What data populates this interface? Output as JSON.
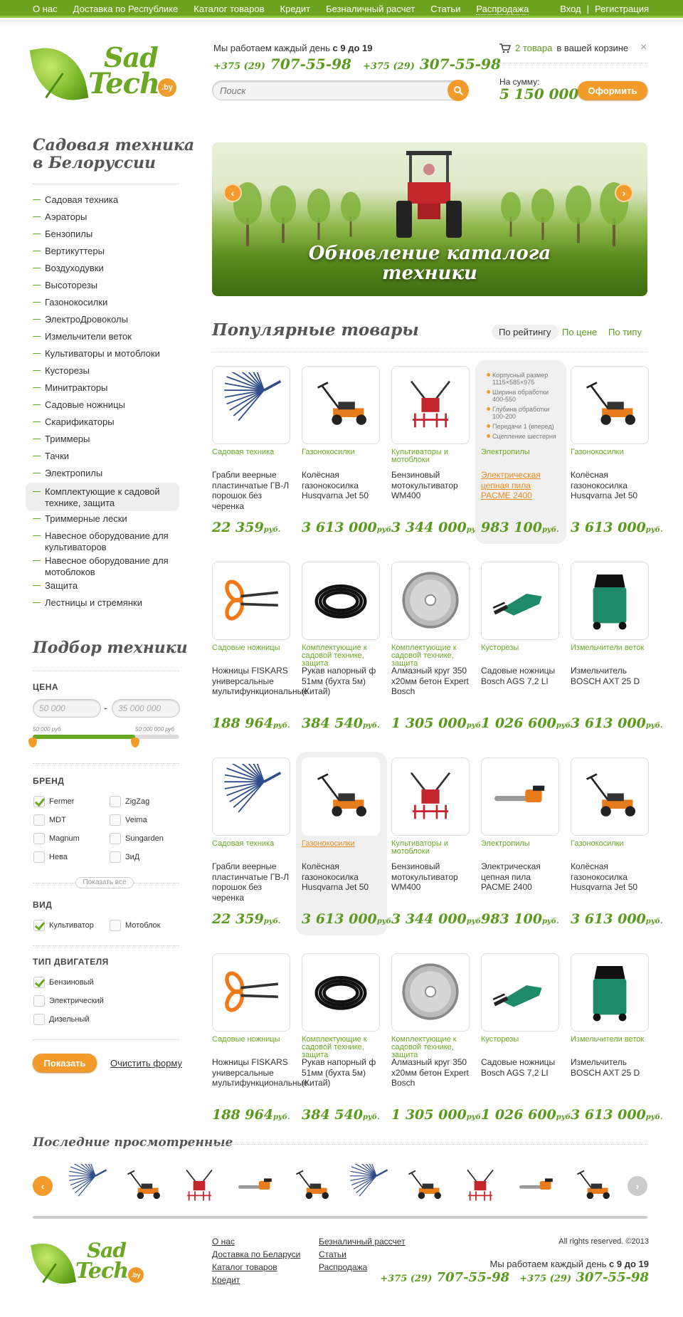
{
  "topnav": {
    "items": [
      "О нас",
      "Доставка по Республике",
      "Каталог товаров",
      "Кредит",
      "Безналичный расчет",
      "Статьи",
      "Распродажа"
    ],
    "login": "Вход",
    "sep": "|",
    "register": "Регистрация"
  },
  "logo": {
    "line1": "Sad",
    "line2": "Tech",
    "badge": ".by"
  },
  "header": {
    "work_prefix": "Мы работаем каждый день",
    "work_hours": "с 9 до 19",
    "phones": [
      {
        "code": "+375 (29)",
        "number": "707-55-98"
      },
      {
        "code": "+375 (29)",
        "number": "307-55-98"
      }
    ],
    "search_placeholder": "Поиск"
  },
  "cart": {
    "link": "2 товара",
    "text": "в вашей корзине",
    "close": "×",
    "sum_label": "На сумму:",
    "sum_value": "5 150 000",
    "order_btn": "Оформить"
  },
  "sidebar": {
    "title_line1": "Садовая техника",
    "title_line2": "в Белоруссии",
    "categories": [
      "Садовая техника",
      "Аэраторы",
      "Бензопилы",
      "Вертикуттеры",
      "Воздуходувки",
      "Высоторезы",
      "Газонокосилки",
      "ЭлектроДровоколы",
      "Измельчители веток",
      "Культиваторы и мотоблоки",
      "Кусторезы",
      "Минитракторы",
      "Садовые ножницы",
      "Скарификаторы",
      "Триммеры",
      "Тачки",
      "Электропилы",
      "Комплектующие к садовой технике, защита",
      "Триммерные лески",
      "Навесное оборудование для культиваторов",
      "Навесное оборудование для мотоблоков",
      "Защита",
      "Лестницы и стремянки"
    ],
    "active_index": 17
  },
  "filter": {
    "title": "Подбор техники",
    "price_head": "ЦЕНА",
    "price_from_placeholder": "50 000",
    "price_dash": "-",
    "price_to_placeholder": "35 000 000",
    "slider_min_label": "50 000 руб",
    "slider_max_label": "50 000 000 руб",
    "slider_range": [
      0.0,
      0.7
    ],
    "brand_head": "БРЕНД",
    "brands": [
      {
        "label": "Fermer",
        "checked": true
      },
      {
        "label": "ZigZag",
        "checked": false
      },
      {
        "label": "MDT",
        "checked": false
      },
      {
        "label": "Veima",
        "checked": false
      },
      {
        "label": "Magnum",
        "checked": false
      },
      {
        "label": "Sungarden",
        "checked": false
      },
      {
        "label": "Нева",
        "checked": false
      },
      {
        "label": "ЗиД",
        "checked": false
      }
    ],
    "show_all": "Показать все",
    "kind_head": "ВИД",
    "kinds": [
      {
        "label": "Культиватор",
        "checked": true
      },
      {
        "label": "Мотоблок",
        "checked": false
      }
    ],
    "engine_head": "ТИП ДВИГАТЕЛЯ",
    "engines": [
      {
        "label": "Бензиновый",
        "checked": true
      },
      {
        "label": "Электрический",
        "checked": false
      },
      {
        "label": "Дизельный",
        "checked": false
      }
    ],
    "show_btn": "Показать",
    "clear_link": "Очистить форму"
  },
  "banner": {
    "title_line1": "Обновление каталога",
    "title_line2": "техники",
    "prev": "‹",
    "next": "›"
  },
  "popular": {
    "title": "Популярные товары",
    "sort": [
      "По рейтингу",
      "По цене",
      "По типу"
    ],
    "currency": "руб.",
    "rows": [
      [
        {
          "cat": "Садовая техника",
          "name": "Грабли веерные пластинчатые ГВ-Л порошок без черенка",
          "price": "22 359",
          "img": "rake-icon"
        },
        {
          "cat": "Газонокосилки",
          "name": "Колёсная газонокосилка Husqvarna Jet 50",
          "price": "3 613 000",
          "img": "lawnmower-icon"
        },
        {
          "cat": "Культиваторы и мотоблоки",
          "name": "Бензиновый мотокультиватор WM400",
          "price": "3 344 000",
          "img": "cultivator-icon"
        },
        {
          "cat": "Электропилы",
          "name": "Электрическая цепная пила PACME 2400",
          "price": "983 100",
          "img": "specs",
          "highlight": true,
          "specs": [
            "Корпусный размер 1115×585×975",
            "Ширина обработки 400-550",
            "Глубина обработки 100-200",
            "Передачи 1 (вперед)",
            "Сцепление шестерня"
          ]
        },
        {
          "cat": "Газонокосилки",
          "name": "Колёсная газонокосилка Husqvarna Jet 50",
          "price": "3 613 000",
          "img": "lawnmower-icon"
        }
      ],
      [
        {
          "cat": "Садовые ножницы",
          "name": "Ножницы FISKARS универсальные мультифункциональные",
          "price": "188 964",
          "img": "scissors-icon"
        },
        {
          "cat": "Комплектующие к садовой технике, защита",
          "name": "Рукав напорный ф 51мм (бухта 5м) (Китай)",
          "price": "384 540",
          "img": "hose-icon"
        },
        {
          "cat": "Комплектующие к садовой технике, защита",
          "name": "Алмазный круг 350 x20мм бетон Expert Bosch",
          "price": "1 305 000",
          "img": "disc-icon"
        },
        {
          "cat": "Кусторезы",
          "name": "Садовые ножницы Bosch AGS 7,2 LI",
          "price": "1 026 600",
          "img": "shears-icon"
        },
        {
          "cat": "Измельчители веток",
          "name": "Измельчитель BOSCH AXT 25 D",
          "price": "3 613 000",
          "img": "shredder-icon"
        }
      ],
      [
        {
          "cat": "Садовая техника",
          "name": "Грабли веерные пластинчатые ГВ-Л порошок без черенка",
          "price": "22 359",
          "img": "rake-icon"
        },
        {
          "cat": "Газонокосилки",
          "name": "Колёсная газонокосилка Husqvarna Jet 50",
          "price": "3 613 000",
          "img": "lawnmower-icon",
          "highlight": true,
          "cat_hover": true
        },
        {
          "cat": "Культиваторы и мотоблоки",
          "name": "Бензиновый мотокультиватор WM400",
          "price": "3 344 000",
          "img": "cultivator-icon"
        },
        {
          "cat": "Электропилы",
          "name": "Электрическая цепная пила PACME 2400",
          "price": "983 100",
          "img": "chainsaw-icon"
        },
        {
          "cat": "Газонокосилки",
          "name": "Колёсная газонокосилка Husqvarna Jet 50",
          "price": "3 613 000",
          "img": "lawnmower-icon"
        }
      ],
      [
        {
          "cat": "Садовые ножницы",
          "name": "Ножницы FISKARS универсальные мультифункциональные",
          "price": "188 964",
          "img": "scissors-icon"
        },
        {
          "cat": "Комплектующие к садовой технике, защита",
          "name": "Рукав напорный ф 51мм (бухта 5м) (Китай)",
          "price": "384 540",
          "img": "hose-icon"
        },
        {
          "cat": "Комплектующие к садовой технике, защита",
          "name": "Алмазный круг 350 x20мм бетон Expert Bosch",
          "price": "1 305 000",
          "img": "disc-icon"
        },
        {
          "cat": "Кусторезы",
          "name": "Садовые ножницы Bosch AGS 7,2 LI",
          "price": "1 026 600",
          "img": "shears-icon"
        },
        {
          "cat": "Измельчители веток",
          "name": "Измельчитель BOSCH AXT 25 D",
          "price": "3 613 000",
          "img": "shredder-icon"
        }
      ]
    ]
  },
  "recent": {
    "title": "Последние просмотренные",
    "items": [
      "rake-icon",
      "lawnmower-icon",
      "cultivator-icon",
      "chainsaw-icon",
      "lawnmower-icon",
      "rake-icon",
      "lawnmower-icon",
      "cultivator-icon",
      "chainsaw-icon",
      "lawnmower-icon"
    ],
    "prev": "‹",
    "next": "›"
  },
  "footer": {
    "col1": [
      "О нас",
      "Доставка по Беларуси",
      "Каталог товаров",
      "Кредит"
    ],
    "col2": [
      "Безналичный рассчет",
      "Статьи",
      "Распродажа"
    ],
    "rights": "All rights reserved. ©2013",
    "work_prefix": "Мы работаем каждый день",
    "work_hours": "с 9 до 19",
    "phones": [
      {
        "code": "+375 (29)",
        "number": "707-55-98"
      },
      {
        "code": "+375 (29)",
        "number": "307-55-98"
      }
    ]
  },
  "colors": {
    "green": "#6da31f",
    "orange": "#f39b2a",
    "price_green": "#5a9a1c"
  }
}
